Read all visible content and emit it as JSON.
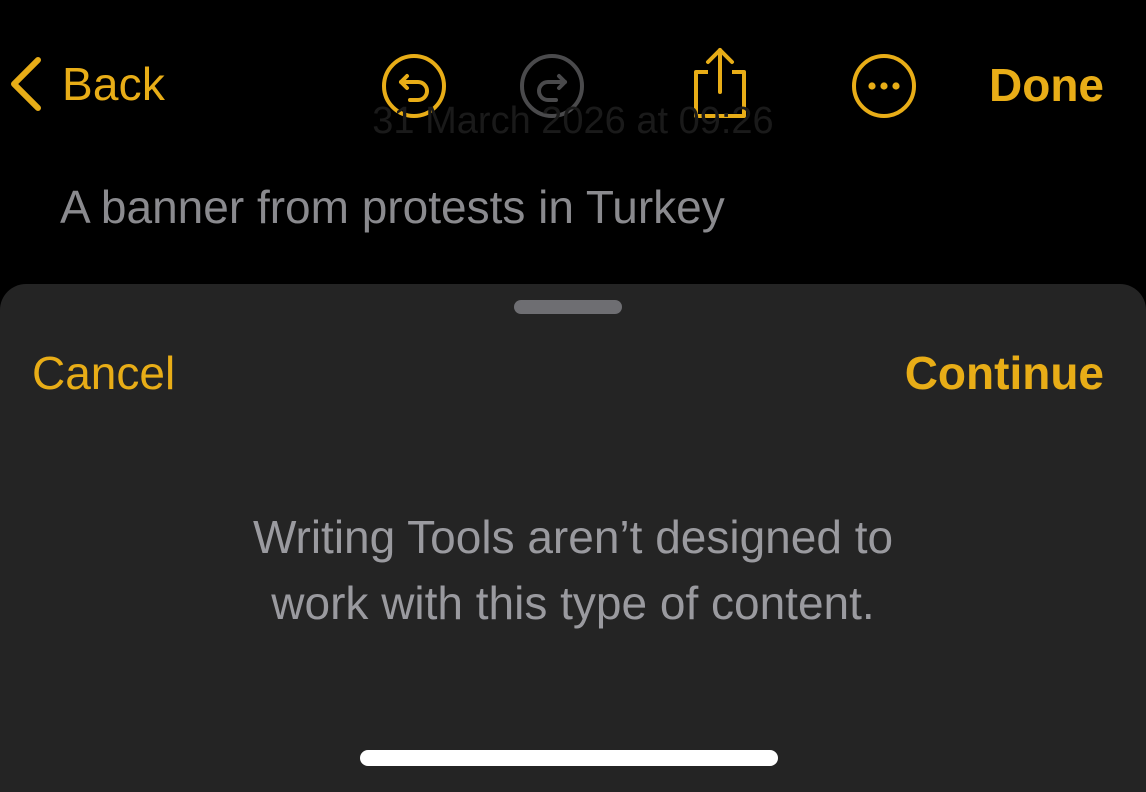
{
  "toolbar": {
    "back_label": "Back",
    "done_label": "Done",
    "icons": [
      "chevron-left-icon",
      "undo-icon",
      "redo-icon",
      "share-icon",
      "more-icon"
    ]
  },
  "note": {
    "date": "31 March 2026 at 09:26",
    "body": "A banner from protests in Turkey"
  },
  "sheet": {
    "cancel_label": "Cancel",
    "continue_label": "Continue",
    "message_line1": "Writing Tools aren’t designed to",
    "message_line2": "work with this type of content."
  },
  "colors": {
    "accent": "#E8AD17",
    "background": "#000000",
    "sheet": "#242424",
    "muted_text": "#9a9a9f",
    "disabled_icon": "#4a4a4c"
  }
}
